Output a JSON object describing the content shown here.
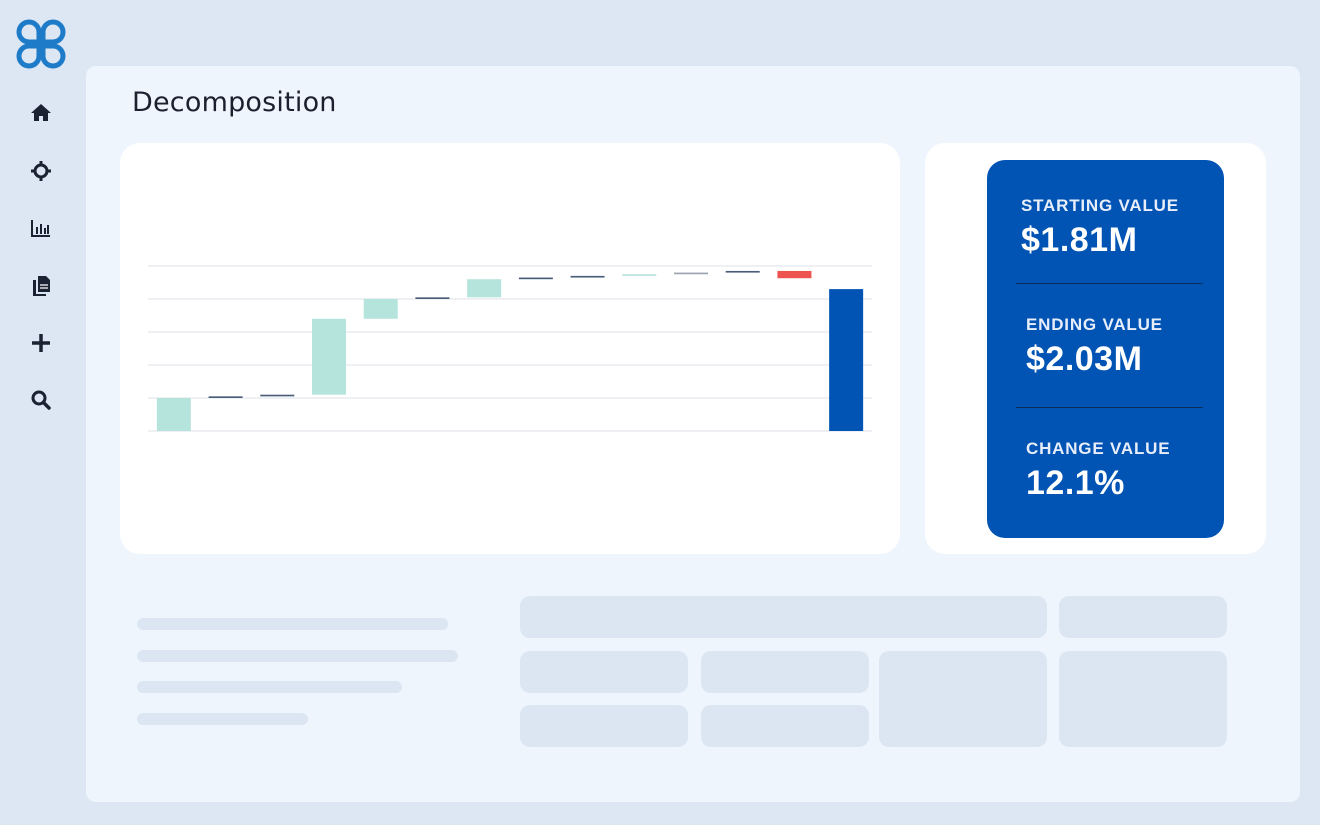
{
  "page": {
    "title": "Decomposition"
  },
  "sidebar": {
    "logo": "clover-logo-icon",
    "items": [
      {
        "icon": "home-icon"
      },
      {
        "icon": "cog-sync-icon"
      },
      {
        "icon": "bar-chart-icon"
      },
      {
        "icon": "documents-icon"
      },
      {
        "icon": "plus-icon"
      },
      {
        "icon": "search-icon"
      }
    ]
  },
  "stats": {
    "starting": {
      "label": "STARTING VALUE",
      "value": "$1.81M"
    },
    "ending": {
      "label": "ENDING VALUE",
      "value": "$2.03M"
    },
    "change": {
      "label": "CHANGE VALUE",
      "value": "12.1%"
    }
  },
  "chart_data": {
    "type": "bar",
    "subtype": "waterfall",
    "series": [
      {
        "values": [
          1.0,
          0.05,
          0.05,
          2.3,
          0.6,
          0.05,
          0.55,
          0.05,
          0.05,
          0.05,
          0.05,
          0.05,
          -0.22,
          4.3
        ]
      }
    ],
    "grid": true,
    "colors": {
      "increase": "#b5e4dc",
      "neutral": "#4a5d78",
      "decrease": "#ef5350",
      "total": "#0154b4"
    }
  }
}
